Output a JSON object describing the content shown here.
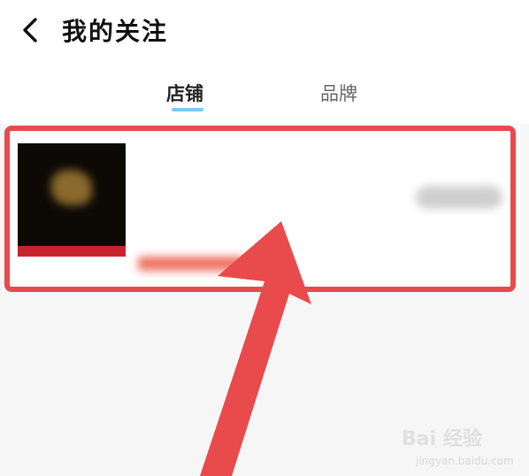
{
  "header": {
    "title": "我的关注"
  },
  "tabs": [
    {
      "label": "店铺",
      "active": true
    },
    {
      "label": "品牌",
      "active": false
    }
  ],
  "shop_card": {
    "name": "",
    "subtitle": "",
    "description": "",
    "right_note": "",
    "tags": [
      "",
      ""
    ]
  },
  "footer": {
    "note": ""
  },
  "annotation": {
    "highlight_color": "#e94a4c"
  },
  "watermark": {
    "main": "Bai 经验",
    "sub": "jingyan.baidu.com"
  },
  "colors": {
    "tab_underline": "#7ec8f2",
    "logo_bg": "#0d0a06",
    "logo_accent": "#c8232c"
  },
  "icons": {
    "back": "chevron-left-icon"
  }
}
